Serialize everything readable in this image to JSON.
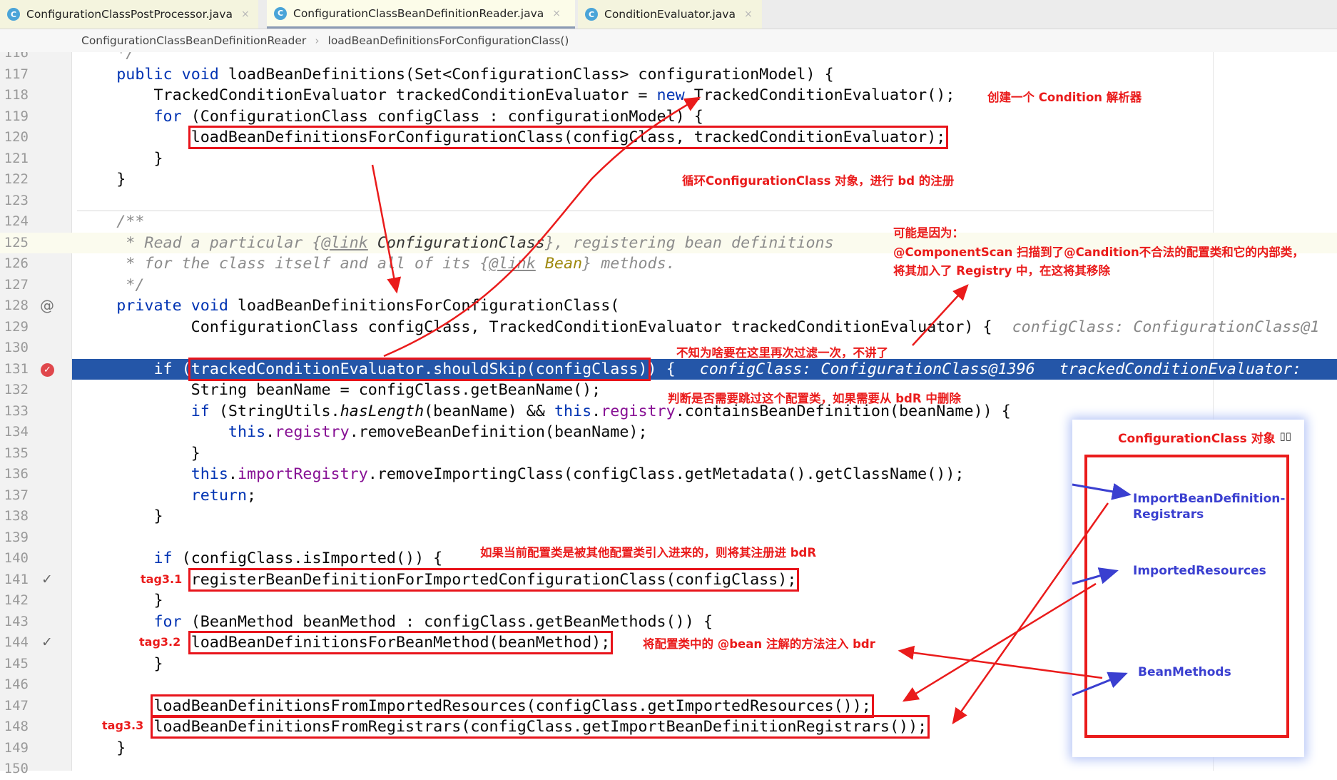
{
  "tabs": [
    {
      "label": "ConfigurationClassPostProcessor.java",
      "active": false
    },
    {
      "label": "ConfigurationClassBeanDefinitionReader.java",
      "active": true
    },
    {
      "label": "ConditionEvaluator.java",
      "active": false
    }
  ],
  "tab_icon_letter": "C",
  "tab_close": "×",
  "breadcrumb": [
    "ConfigurationClassBeanDefinitionReader",
    "loadBeanDefinitionsForConfigurationClass()"
  ],
  "breadcrumb_sep": "›",
  "code": {
    "current_line": 125,
    "breakpoint_line": 131,
    "lines": [
      {
        "n": "116",
        "t": [
          [
            "    */",
            "cm"
          ]
        ]
      },
      {
        "n": "117",
        "t": [
          [
            "    ",
            ""
          ],
          [
            "public void ",
            "kw"
          ],
          [
            "loadBeanDefinitions(Set<ConfigurationClass> configurationModel) {",
            ""
          ]
        ]
      },
      {
        "n": "118",
        "t": [
          [
            "        TrackedConditionEvaluator trackedConditionEvaluator = ",
            ""
          ],
          [
            "new ",
            "kw"
          ],
          [
            "TrackedConditionEvaluator();",
            ""
          ]
        ]
      },
      {
        "n": "119",
        "t": [
          [
            "        ",
            ""
          ],
          [
            "for ",
            "kw"
          ],
          [
            "(ConfigurationClass configClass : configurationModel) {",
            ""
          ]
        ]
      },
      {
        "n": "120",
        "t": [
          [
            "            ",
            ""
          ],
          [
            "loadBeanDefinitionsForConfigurationClass(configClass, trackedConditionEvaluator);",
            "box"
          ]
        ]
      },
      {
        "n": "121",
        "t": [
          [
            "        }",
            ""
          ]
        ]
      },
      {
        "n": "122",
        "t": [
          [
            "    }",
            ""
          ]
        ]
      },
      {
        "n": "123",
        "t": []
      },
      {
        "n": "124",
        "t": [
          [
            "    /**",
            "cm"
          ]
        ]
      },
      {
        "n": "125",
        "t": [
          [
            "     * Read a particular {",
            "cm"
          ],
          [
            "@link",
            "cmtag"
          ],
          [
            " ",
            "cm"
          ],
          [
            "ConfigurationClass",
            "cmref"
          ],
          [
            "}, registering bean definitions",
            "cm"
          ]
        ]
      },
      {
        "n": "126",
        "t": [
          [
            "     * for the class itself and all of its {",
            "cm"
          ],
          [
            "@link",
            "cmtag"
          ],
          [
            " ",
            "cm"
          ],
          [
            "Bean",
            "cmbean"
          ],
          [
            "} methods.",
            "cm"
          ]
        ]
      },
      {
        "n": "127",
        "t": [
          [
            "     */",
            "cm"
          ]
        ]
      },
      {
        "n": "128",
        "g": "at",
        "t": [
          [
            "    ",
            ""
          ],
          [
            "private void ",
            "kw"
          ],
          [
            "loadBeanDefinitionsForConfigurationClass(",
            ""
          ]
        ]
      },
      {
        "n": "129",
        "t": [
          [
            "            ConfigurationClass configClass, TrackedConditionEvaluator trackedConditionEvaluator) {",
            ""
          ],
          [
            "configClass: ConfigurationClass@1",
            "hint"
          ]
        ]
      },
      {
        "n": "130",
        "t": []
      },
      {
        "n": "131",
        "g": "breakpoint",
        "t": [
          [
            "        ",
            ""
          ],
          [
            "if ",
            "kw"
          ],
          [
            "(",
            ""
          ],
          [
            "trackedConditionEvaluator.shouldSkip(configClass)",
            "box"
          ],
          [
            ") {",
            ""
          ],
          [
            "configClass: ConfigurationClass@1396",
            "hint"
          ],
          [
            "trackedConditionEvaluator:",
            "hint"
          ]
        ]
      },
      {
        "n": "132",
        "t": [
          [
            "            String beanName = configClass.getBeanName();",
            ""
          ]
        ]
      },
      {
        "n": "133",
        "t": [
          [
            "            ",
            ""
          ],
          [
            "if ",
            "kw"
          ],
          [
            "(StringUtils.",
            ""
          ],
          [
            "hasLength",
            "it"
          ],
          [
            "(beanName) && ",
            ""
          ],
          [
            "this",
            "kw"
          ],
          [
            ".",
            ""
          ],
          [
            "registry",
            "fld"
          ],
          [
            ".containsBeanDefinition(beanName)) {",
            ""
          ]
        ]
      },
      {
        "n": "134",
        "t": [
          [
            "                ",
            ""
          ],
          [
            "this",
            "kw"
          ],
          [
            ".",
            ""
          ],
          [
            "registry",
            "fld"
          ],
          [
            ".removeBeanDefinition(beanName);",
            ""
          ]
        ]
      },
      {
        "n": "135",
        "t": [
          [
            "            }",
            ""
          ]
        ]
      },
      {
        "n": "136",
        "t": [
          [
            "            ",
            ""
          ],
          [
            "this",
            "kw"
          ],
          [
            ".",
            ""
          ],
          [
            "importRegistry",
            "fld"
          ],
          [
            ".removeImportingClass(configClass.getMetadata().getClassName());",
            ""
          ]
        ]
      },
      {
        "n": "137",
        "t": [
          [
            "            ",
            ""
          ],
          [
            "return",
            "kw"
          ],
          [
            ";",
            ""
          ]
        ]
      },
      {
        "n": "138",
        "t": [
          [
            "        }",
            ""
          ]
        ]
      },
      {
        "n": "139",
        "t": []
      },
      {
        "n": "140",
        "t": [
          [
            "        ",
            ""
          ],
          [
            "if ",
            "kw"
          ],
          [
            "(configClass.isImported()) {",
            ""
          ]
        ]
      },
      {
        "n": "141",
        "g": "check",
        "t": [
          [
            "            ",
            ""
          ],
          [
            "registerBeanDefinitionForImportedConfigurationClass(configClass);",
            "box"
          ]
        ]
      },
      {
        "n": "142",
        "t": [
          [
            "        }",
            ""
          ]
        ]
      },
      {
        "n": "143",
        "t": [
          [
            "        ",
            ""
          ],
          [
            "for ",
            "kw"
          ],
          [
            "(BeanMethod beanMethod : configClass.getBeanMethods()) {",
            ""
          ]
        ]
      },
      {
        "n": "144",
        "g": "check",
        "t": [
          [
            "            ",
            ""
          ],
          [
            "loadBeanDefinitionsForBeanMethod(beanMethod);",
            "box"
          ]
        ]
      },
      {
        "n": "145",
        "t": [
          [
            "        }",
            ""
          ]
        ]
      },
      {
        "n": "146",
        "t": []
      },
      {
        "n": "147",
        "t": [
          [
            "        ",
            ""
          ],
          [
            "loadBeanDefinitionsFromImportedResources(configClass.getImportedResources());",
            "box"
          ]
        ]
      },
      {
        "n": "148",
        "t": [
          [
            "        ",
            ""
          ],
          [
            "loadBeanDefinitionsFromRegistrars(configClass.getImportBeanDefinitionRegistrars());",
            "box"
          ]
        ]
      },
      {
        "n": "149",
        "t": [
          [
            "    }",
            ""
          ]
        ]
      },
      {
        "n": "150",
        "t": []
      }
    ]
  },
  "gutter_icons": {
    "at": "@",
    "breakpoint": "✓",
    "check": "✓"
  },
  "annotations": {
    "create_parser": "创建一个 Condition 解析器",
    "loop": "循环ConfigurationClass 对象，进行 bd 的注册",
    "maybe_1": "可能是因为：",
    "maybe_2": "@ComponentScan 扫描到了@Candition不合法的配置类和它的内部类，",
    "maybe_3": "将其加入了 Registry 中，在这将其移除",
    "filter_again": "不知为啥要在这里再次过滤一次，不讲了",
    "skip_check": "判断是否需要跳过这个配置类，如果需要从 bdR 中删除",
    "imported": "如果当前配置类是被其他配置类引入进来的，则将其注册进 bdR",
    "bean_methods": "将配置类中的 @bean 注解的方法注入 bdr",
    "tag31": "tag3.1",
    "tag32": "tag3.2",
    "tag33": "tag3.3"
  },
  "panel": {
    "title": "ConfigurationClass 对象",
    "fields": [
      "ImportBeanDefinition-",
      "Registrars",
      "ImportedResources",
      "BeanMethods"
    ]
  },
  "colors": {
    "annotation_red": "#ea1b1b",
    "field_blue": "#3a3fd0",
    "breakpoint_line": "#2456a8",
    "keyword": "#0033b3"
  }
}
